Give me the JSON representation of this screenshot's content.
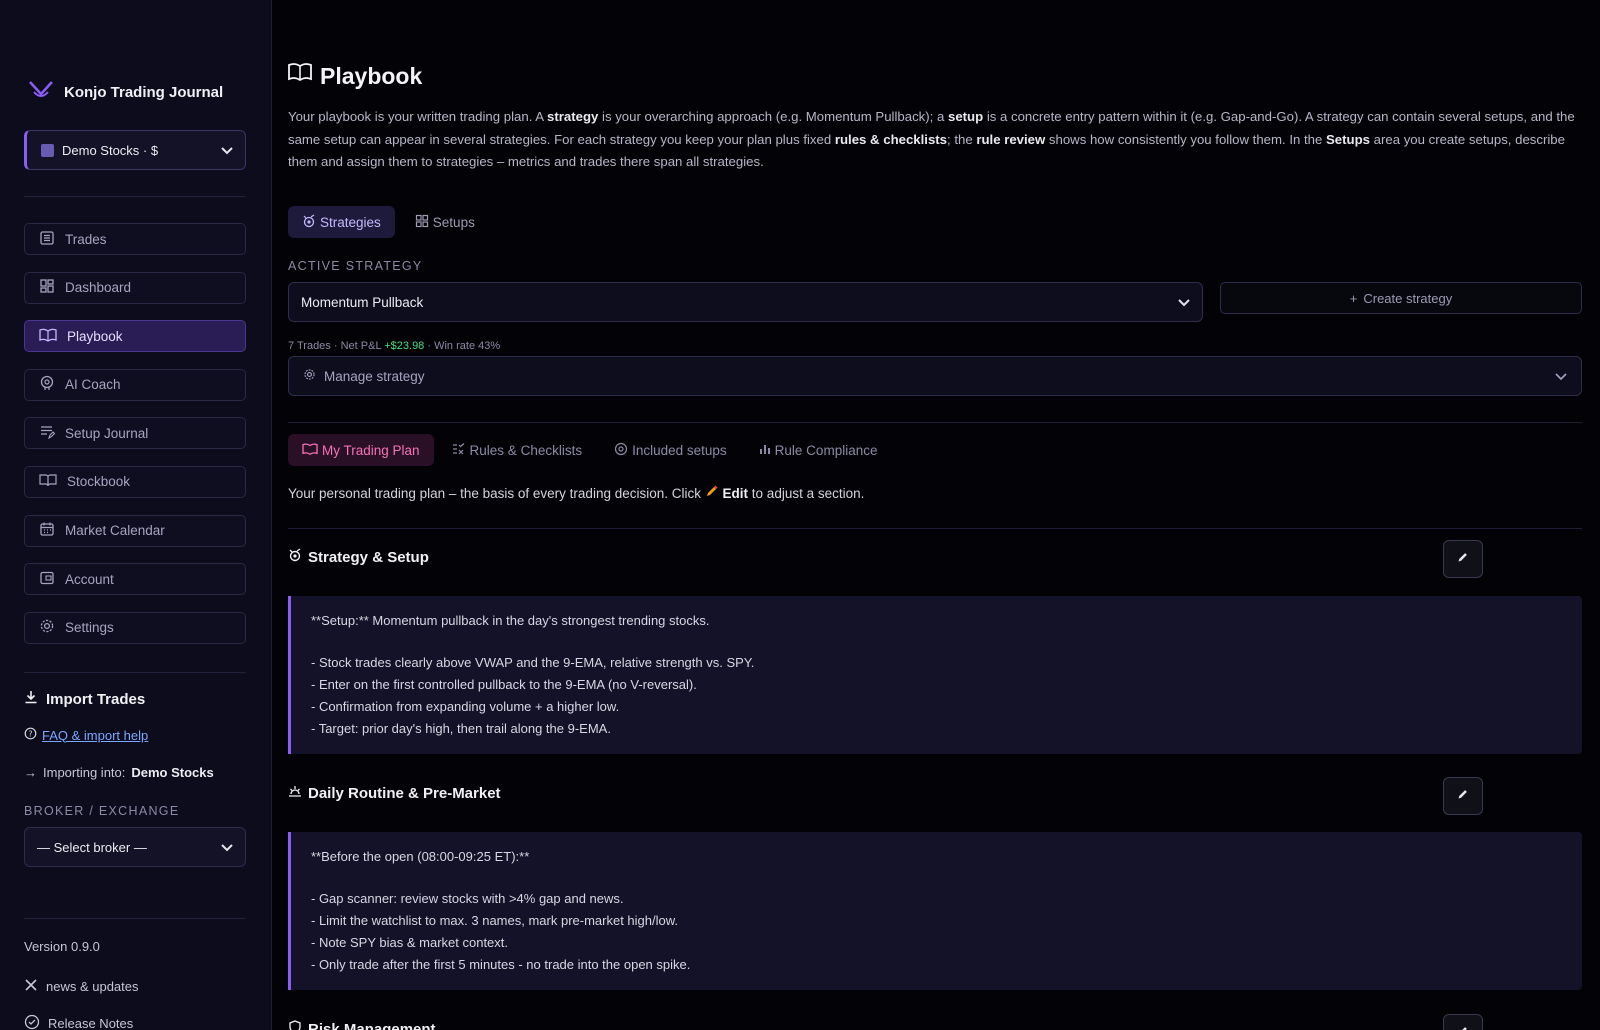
{
  "sidebar": {
    "brand": "Konjo Trading Journal",
    "account": "Demo Stocks · $",
    "nav": [
      {
        "label": "Trades",
        "icon": "list-icon"
      },
      {
        "label": "Dashboard",
        "icon": "grid-icon"
      },
      {
        "label": "Playbook",
        "icon": "book-icon"
      },
      {
        "label": "AI Coach",
        "icon": "brain-icon"
      },
      {
        "label": "Setup Journal",
        "icon": "edit-list-icon"
      },
      {
        "label": "Stockbook",
        "icon": "open-book-icon"
      },
      {
        "label": "Market Calendar",
        "icon": "calendar-icon"
      },
      {
        "label": "Account",
        "icon": "wallet-icon"
      },
      {
        "label": "Settings",
        "icon": "gear-icon"
      }
    ],
    "import_title": "Import Trades",
    "faq_link": "FAQ & import help",
    "importing_prefix": "Importing into:",
    "importing_target": "Demo Stocks",
    "broker_label": "BROKER / EXCHANGE",
    "broker_placeholder": "— Select broker —",
    "version": "Version 0.9.0",
    "news": "news & updates",
    "release": "Release Notes"
  },
  "main": {
    "title": "Playbook",
    "intro": {
      "p1": "Your playbook is your written trading plan. A ",
      "b1": "strategy",
      "p2": " is your overarching approach (e.g. Momentum Pullback); a ",
      "b2": "setup",
      "p3": " is a concrete entry pattern within it (e.g. Gap-and-Go). A strategy can contain several setups, and the same setup can appear in several strategies. For each strategy you keep your plan plus fixed ",
      "b3": "rules & checklists",
      "p4": "; the ",
      "b4": "rule review",
      "p5": " shows how consistently you follow them. In the ",
      "b5": "Setups",
      "p6": " area you create setups, describe them and assign them to strategies – metrics and trades there span all strategies."
    },
    "top_tabs": [
      "Strategies",
      "Setups"
    ],
    "active_strategy_label": "ACTIVE STRATEGY",
    "active_strategy": "Momentum Pullback",
    "create_strategy": "Create strategy",
    "stats": {
      "trades": "7 Trades",
      "pnl_label": "Net P&L",
      "pnl_value": "+$23.98",
      "winrate": "Win rate 43%"
    },
    "manage_strategy": "Manage strategy",
    "sub_tabs": [
      "My Trading Plan",
      "Rules & Checklists",
      "Included setups",
      "Rule Compliance"
    ],
    "plan_intro": {
      "p1": "Your personal trading plan – the basis of every trading decision. Click",
      "edit": "Edit",
      "p2": "to adjust a section."
    },
    "sections": [
      {
        "title": "Strategy & Setup",
        "lead": "**Setup:** Momentum pullback in the day's strongest trending stocks.",
        "items": [
          "- Stock trades clearly above VWAP and the 9-EMA, relative strength vs. SPY.",
          "- Enter on the first controlled pullback to the 9-EMA (no V-reversal).",
          "- Confirmation from expanding volume + a higher low.",
          "- Target: prior day's high, then trail along the 9-EMA."
        ]
      },
      {
        "title": "Daily Routine & Pre-Market",
        "lead": "**Before the open (08:00-09:25 ET):**",
        "items": [
          "- Gap scanner: review stocks with >4% gap and news.",
          "- Limit the watchlist to max. 3 names, mark pre-market high/low.",
          "- Note SPY bias & market context.",
          "- Only trade after the first 5 minutes - no trade into the open spike."
        ]
      },
      {
        "title": "Risk Management"
      }
    ]
  },
  "colors": {
    "accent": "#8b5cf6",
    "positive": "#4ade80",
    "link": "#7aa7ff",
    "pink_tab": "#f472b6"
  }
}
